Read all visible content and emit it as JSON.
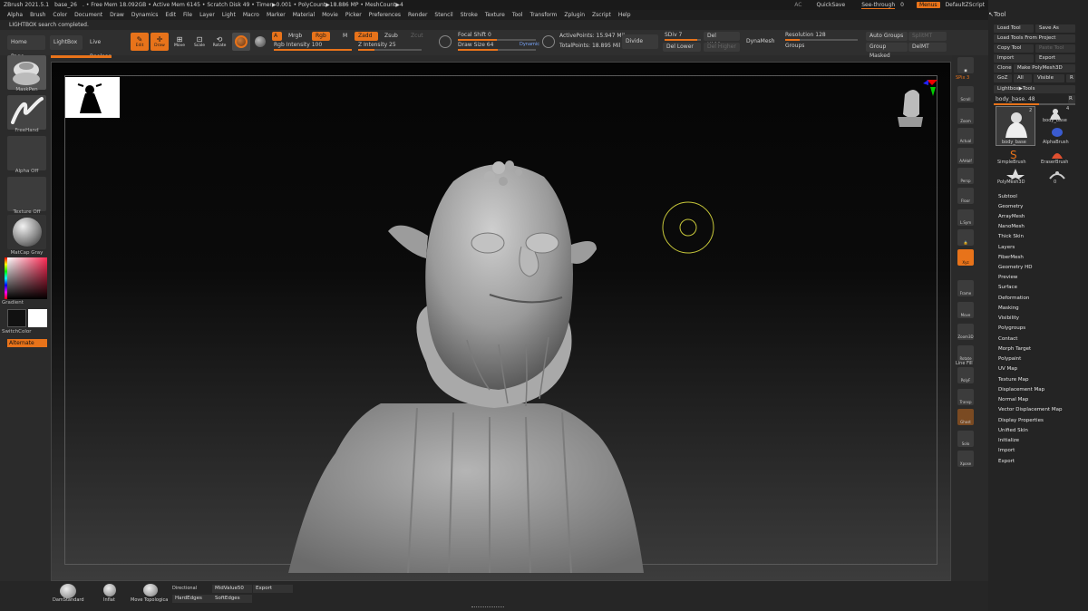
{
  "titlebar": {
    "app": "ZBrush 2021.5.1",
    "doc": "base_26",
    "stats": ". • Free Mem 18.092GB • Active Mem 6145 • Scratch Disk 49 • Timer▶0.001 • PolyCount▶18.886 MP • MeshCount▶4",
    "ac": "AC",
    "quicksave": "QuickSave",
    "seethrough": "See-through",
    "seethrough_val": "0",
    "menus": "Menus",
    "defaultzscript": "DefaultZScript"
  },
  "menubar": [
    "Alpha",
    "Brush",
    "Color",
    "Document",
    "Draw",
    "Dynamics",
    "Edit",
    "File",
    "Layer",
    "Light",
    "Macro",
    "Marker",
    "Material",
    "Movie",
    "Picker",
    "Preferences",
    "Render",
    "Stencil",
    "Stroke",
    "Texture",
    "Tool",
    "Transform",
    "Zplugin",
    "Zscript",
    "Help"
  ],
  "status": "LIGHTBOX search completed.",
  "toolbar": {
    "home": "Home Page",
    "lightbox": "LightBox",
    "liveboolean": "Live Boolean",
    "edit": "Edit",
    "draw": "Draw",
    "move": "Move",
    "scale": "Scale",
    "rotate": "Rotate",
    "a": "A",
    "mrgb": "Mrgb",
    "rgb": "Rgb",
    "m": "M",
    "zadd": "Zadd",
    "zsub": "Zsub",
    "zcut": "Zcut",
    "rgb_intensity": "Rgb Intensity 100",
    "z_intensity": "Z Intensity 25",
    "focal_shift": "Focal Shift 0",
    "draw_size": "Draw Size 64",
    "dynamic": "Dynamic",
    "active_points": "ActivePoints: 15.947 Mil",
    "total_points": "TotalPoints: 18.895 Mil",
    "divide": "Divide",
    "sdiv": "SDiv 7",
    "del_lower": "Del Lower",
    "del_hidden": "Del Hidden",
    "del_higher": "Del Higher",
    "dynamesh": "DynaMesh",
    "resolution": "Resolution 128",
    "groups": "Groups",
    "auto_groups": "Auto Groups",
    "splitmt": "SplitMT",
    "group_masked": "Group Masked",
    "delmt": "DelMT"
  },
  "leftshelf": {
    "maskpen": "MaskPen",
    "freehand": "FreeHand",
    "alpha": "Alpha Off",
    "texture": "Texture Off",
    "matcap": "MatCap Gray",
    "gradient": "Gradient",
    "switchcolor": "SwitchColor",
    "alternate": "Alternate"
  },
  "rightbar": [
    "SPix 3",
    "Scroll",
    "Zoom",
    "Actual",
    "AAHalf",
    "Persp",
    "Floor",
    "L.Sym",
    "Xyz",
    "Frame",
    "Move",
    "Zoom3D",
    "Rotate",
    "Line Fill",
    "PolyF",
    "Transp",
    "Ghost",
    "Solo",
    "Xpose"
  ],
  "toolpanel": {
    "title": "Tool",
    "load_tool": "Load Tool",
    "save_as": "Save As",
    "load_from_project": "Load Tools From Project",
    "copy_tool": "Copy Tool",
    "paste_tool": "Paste Tool",
    "import": "Import",
    "export": "Export",
    "clone": "Clone",
    "make_polymesh": "Make PolyMesh3D",
    "goz": "GoZ",
    "all": "All",
    "visible": "Visible",
    "r": "R",
    "lightbox_tools": "Lightbox▶Tools",
    "tool_name": "body_base. 48",
    "r2": "R",
    "thumbs": [
      {
        "label": "body_base",
        "num": "2"
      },
      {
        "label": "body_base",
        "num": "4"
      },
      {
        "label": "AlphaBrush",
        "num": ""
      },
      {
        "label": "SimpleBrush",
        "num": ""
      },
      {
        "label": "EraserBrush",
        "num": ""
      },
      {
        "label": "PolyMesh3D",
        "num": ""
      },
      {
        "label": "0",
        "num": ""
      }
    ],
    "subpalettes": [
      "Subtool",
      "Geometry",
      "ArrayMesh",
      "NanoMesh",
      "Thick Skin",
      "Layers",
      "FiberMesh",
      "Geometry HD",
      "Preview",
      "Surface",
      "Deformation",
      "Masking",
      "Visibility",
      "Polygroups",
      "Contact",
      "Morph Target",
      "Polypaint",
      "UV Map",
      "Texture Map",
      "Displacement Map",
      "Normal Map",
      "Vector Displacement Map",
      "Display Properties",
      "Unified Skin",
      "Initialize",
      "Import",
      "Export"
    ]
  },
  "bottombar": {
    "damstandard": "DamStandard",
    "inflat": "Inflat",
    "move_topological": "Move Topologica",
    "directional": "Directional",
    "midvalue": "MidValue50",
    "export": "Export",
    "hardedges": "HardEdges",
    "softedges": "SoftEdges"
  },
  "colors": {
    "accent": "#e8731a",
    "bg": "#2b2b2b"
  }
}
